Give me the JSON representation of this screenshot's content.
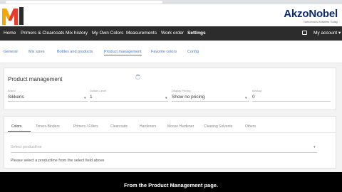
{
  "brand": {
    "logo_text": "MIXIT",
    "name": "AkzoNobel",
    "tagline": "Tomorrow's Answers Today"
  },
  "nav": {
    "items": [
      {
        "label": "Home"
      },
      {
        "label": "Primers & Clearcoats"
      },
      {
        "label": "Mix history"
      },
      {
        "label": "My Own Colors"
      },
      {
        "label": "Measurements"
      },
      {
        "label": "Work order"
      },
      {
        "label": "Settings",
        "active": true
      }
    ],
    "account_label": "My account",
    "account_icon": "monitor-icon"
  },
  "subnav": {
    "items": [
      {
        "label": "General"
      },
      {
        "label": "Mix sizes"
      },
      {
        "label": "Bottles and products"
      },
      {
        "label": "Product management",
        "active": true
      },
      {
        "label": "Favorite colors"
      },
      {
        "label": "Config"
      }
    ]
  },
  "product_management": {
    "title": "Product management",
    "fields": [
      {
        "label": "Brand",
        "value": "Sikkens"
      },
      {
        "label": "Dollars Level",
        "value": "1"
      },
      {
        "label": "Display Pricing",
        "value": "Show no pricing"
      },
      {
        "label": "Markup",
        "value": "0"
      }
    ]
  },
  "tabs": {
    "items": [
      {
        "label": "Colors",
        "active": true
      },
      {
        "label": "Toners-Binders"
      },
      {
        "label": "Primers / Fillers"
      },
      {
        "label": "Clearcoats"
      },
      {
        "label": "Hardeners"
      },
      {
        "label": "Moose Hardener"
      },
      {
        "label": "Cleaning Solvents"
      },
      {
        "label": "Others"
      }
    ]
  },
  "productline": {
    "placeholder": "Select productline",
    "hint": "Please select a productline from the select field above"
  },
  "caption": {
    "text": "From the Product Management page."
  },
  "colors": {
    "navbar": "#2c2c2c",
    "link": "#3d7bd6",
    "brand": "#0d2b6b"
  }
}
